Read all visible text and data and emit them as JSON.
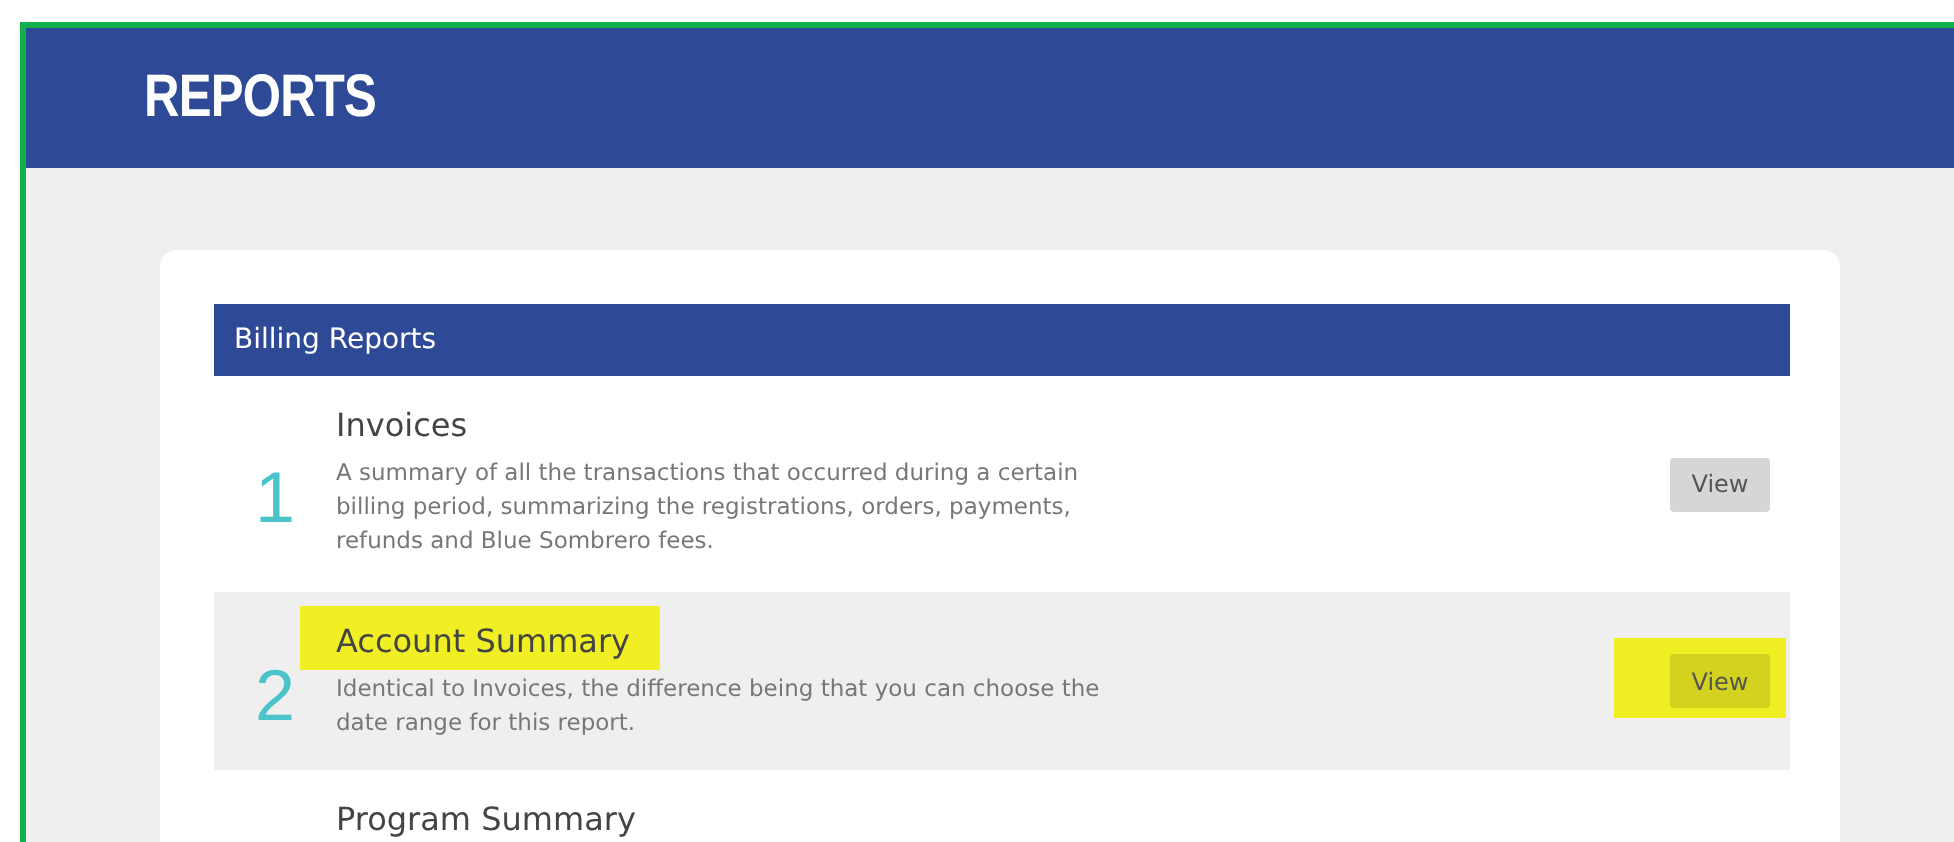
{
  "header": {
    "title": "REPORTS"
  },
  "section": {
    "title": "Billing Reports",
    "reports": [
      {
        "number": "1",
        "title": "Invoices",
        "description": "A summary of all the transactions that occurred during a certain billing period, summarizing the registrations, orders, payments, refunds and Blue Sombrero fees.",
        "button": "View",
        "hovered": false,
        "marked": false
      },
      {
        "number": "2",
        "title": "Account Summary",
        "description": "Identical to Invoices, the difference being that you can choose the date range for this report.",
        "button": "View",
        "hovered": true,
        "marked": true
      },
      {
        "title": "Program Summary",
        "hovered": false,
        "marked": false
      }
    ]
  }
}
